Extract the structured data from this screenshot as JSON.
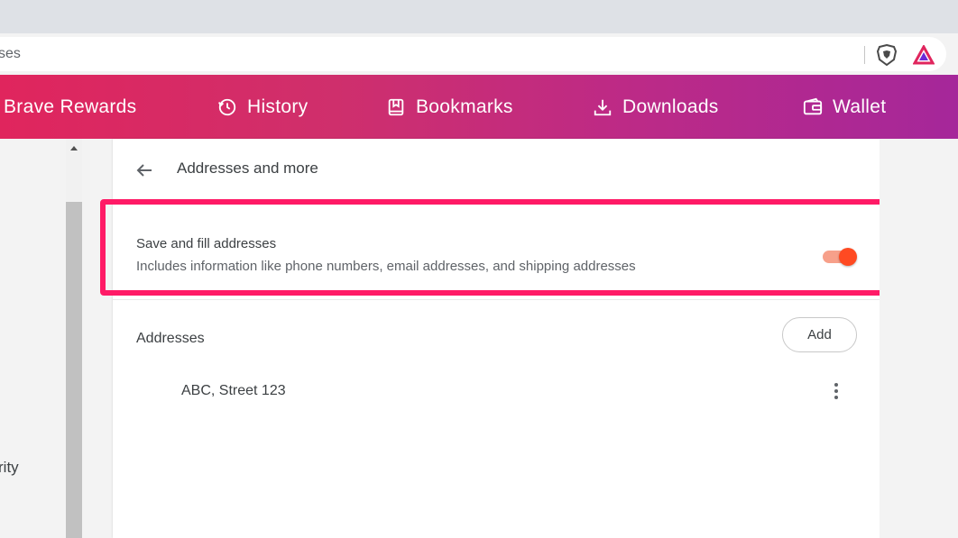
{
  "url_partial": "ses",
  "nav": {
    "items": [
      {
        "label": "Brave Rewards",
        "icon": "brave-rewards-icon"
      },
      {
        "label": "History",
        "icon": "history-icon"
      },
      {
        "label": "Bookmarks",
        "icon": "bookmarks-icon"
      },
      {
        "label": "Downloads",
        "icon": "downloads-icon"
      },
      {
        "label": "Wallet",
        "icon": "wallet-icon"
      }
    ]
  },
  "sidebar": {
    "partial_item": "rity"
  },
  "page": {
    "title": "Addresses and more",
    "save_setting": {
      "title": "Save and fill addresses",
      "description": "Includes information like phone numbers, email addresses, and shipping addresses",
      "enabled": true
    },
    "addresses_section": {
      "label": "Addresses",
      "add_label": "Add",
      "items": [
        "ABC, Street 123"
      ]
    }
  },
  "colors": {
    "nav_gradient_start": "#e0255d",
    "nav_gradient_end": "#a5279a",
    "highlight": "#ff1a66",
    "toggle_on": "#ff4a22"
  }
}
